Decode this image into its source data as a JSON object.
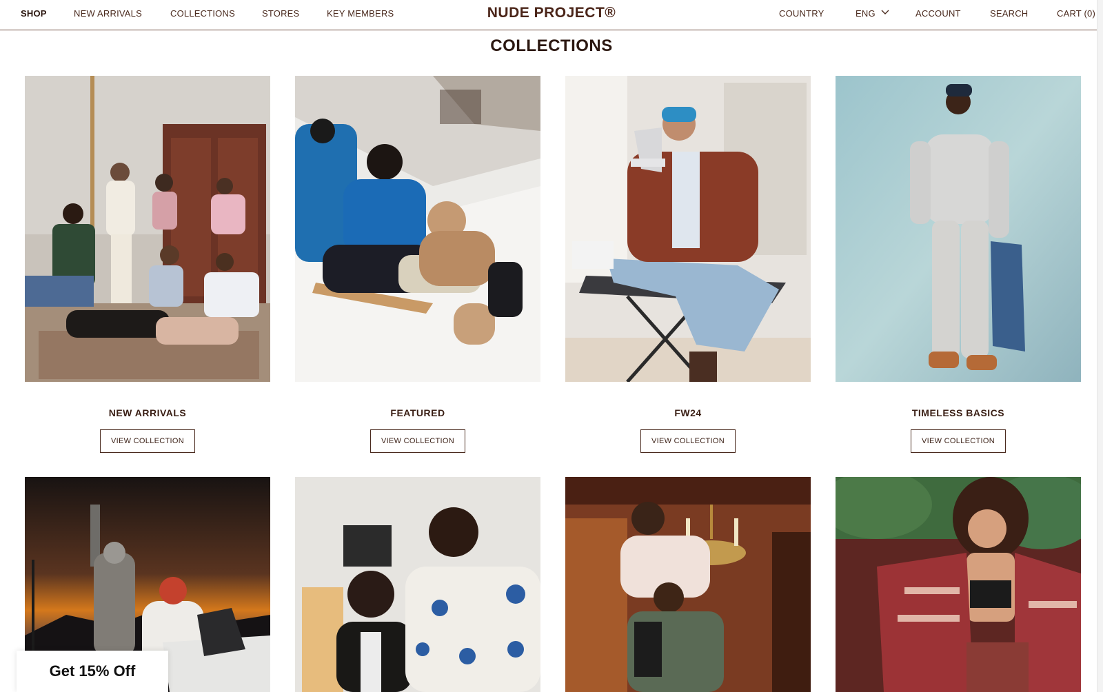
{
  "header": {
    "nav_left": [
      {
        "label": "SHOP",
        "active": true
      },
      {
        "label": "NEW ARRIVALS"
      },
      {
        "label": "COLLECTIONS"
      },
      {
        "label": "STORES"
      },
      {
        "label": "KEY MEMBERS"
      }
    ],
    "brand": "NUDE PROJECT®",
    "nav_right": {
      "country": "COUNTRY",
      "language": "ENG",
      "account": "ACCOUNT",
      "search": "SEARCH",
      "cart": "CART (0)"
    }
  },
  "page_title": "COLLECTIONS",
  "collections": [
    {
      "title": "NEW ARRIVALS",
      "button": "VIEW COLLECTION"
    },
    {
      "title": "FEATURED",
      "button": "VIEW COLLECTION"
    },
    {
      "title": "FW24",
      "button": "VIEW COLLECTION"
    },
    {
      "title": "TIMELESS BASICS",
      "button": "VIEW COLLECTION"
    }
  ],
  "promo": {
    "label": "Get 15% Off"
  },
  "colors": {
    "brand": "#4a2418",
    "text": "#3a1f15",
    "border": "#6b4a3a"
  }
}
